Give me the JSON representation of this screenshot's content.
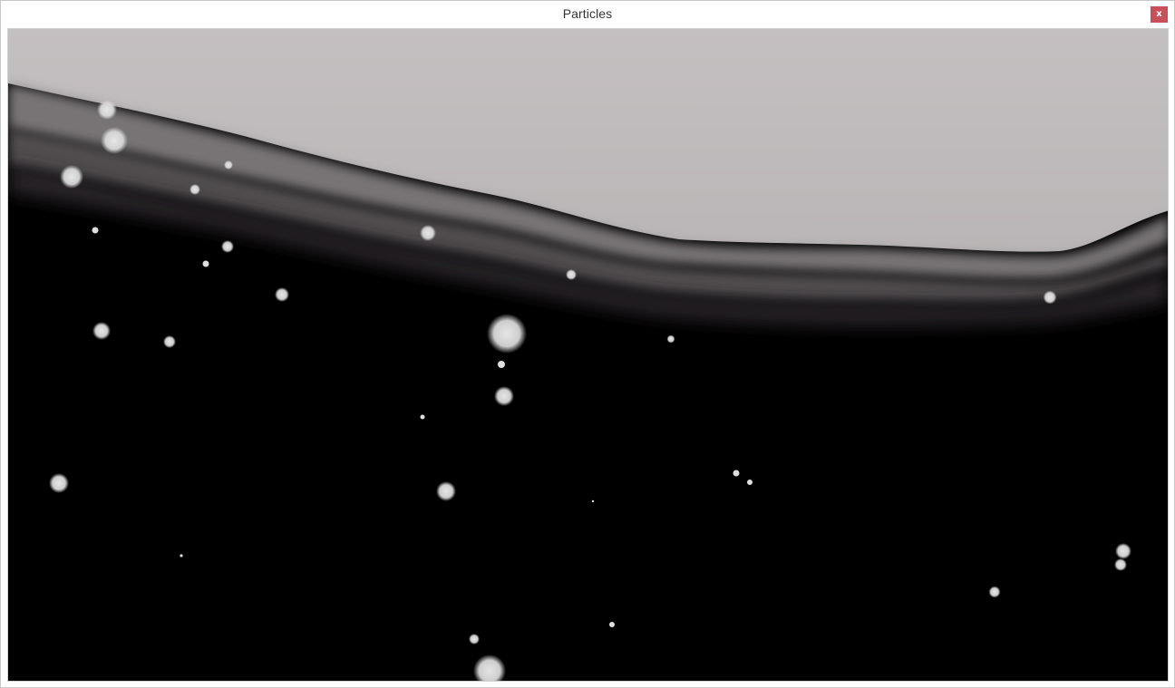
{
  "window": {
    "title": "Particles",
    "close_label": "x"
  },
  "scene": {
    "background_color": "#000000",
    "sky_color": "#bdb8b9",
    "particle_color": "#dedede"
  },
  "icons": {
    "close": "close-icon"
  }
}
